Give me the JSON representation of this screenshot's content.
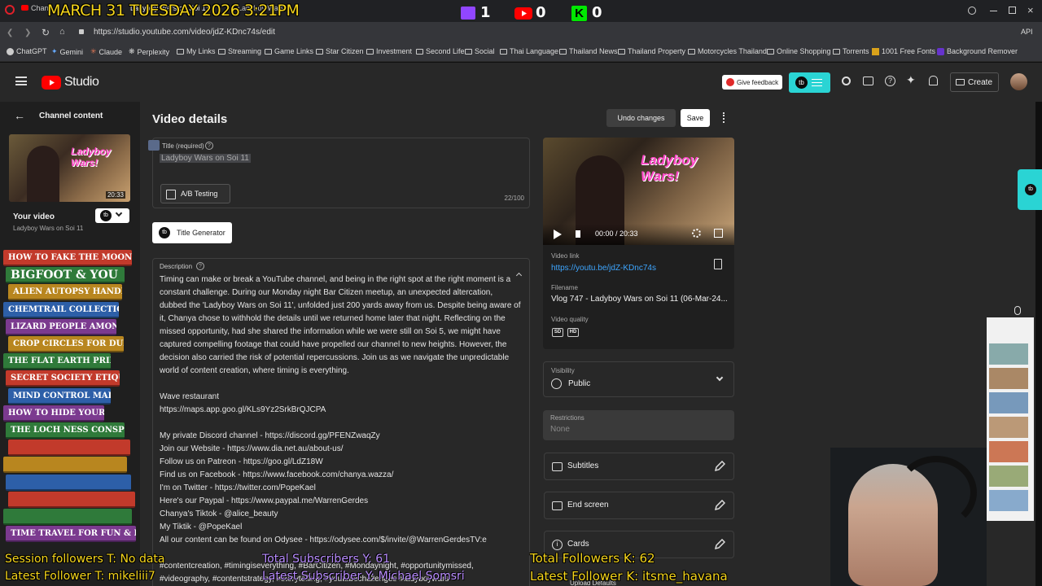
{
  "browser": {
    "tabs": [
      "Chann",
      "Ladyboy Wars on Soi 11",
      "Ladyboy Wars"
    ],
    "url": "https://studio.youtube.com/video/jdZ-KDnc74s/edit",
    "bookmarks": [
      "ChatGPT",
      "Gemini",
      "Claude",
      "Perplexity",
      "My Links",
      "Streaming",
      "Game Links",
      "Star Citizen",
      "Investment",
      "Second Life",
      "Social",
      "Thai Language",
      "Thailand News",
      "Thailand Property",
      "Motorcycles Thailand",
      "Online Shopping",
      "Torrents",
      "1001 Free Fonts",
      "Background Remover"
    ]
  },
  "overlay": {
    "datetime": "MARCH 31 TUESDAY 2026 3:21PM",
    "twitch_count": "1",
    "youtube_count": "0",
    "kick_count": "0",
    "session_followers": "Session followers T: No data",
    "latest_follower_t": "Latest Follower T: mikeliii7",
    "total_subscribers": "Total Subscribers Y: 61",
    "latest_subscriber": "Latest Subscriber Y: Michael Somsri",
    "total_followers_k": "Total Followers K: 62",
    "latest_follower_k": "Latest Follower K: itsme_havana"
  },
  "studio": {
    "logo_text": "Studio",
    "feedback": "Give feedback",
    "create": "Create"
  },
  "nav": {
    "back_label": "Channel content",
    "duration": "20:33",
    "your_video": "Your video",
    "video_title": "Ladyboy Wars on Soi 11",
    "books": [
      "HOW TO FAKE THE MOON LANDING",
      "BIGFOOT & YOU",
      "ALIEN AUTOPSY HANDBOOK",
      "CHEMTRAIL COLLECTION GUIDE",
      "LIZARD PEOPLE AMONG US",
      "CROP CIRCLES FOR DUMMIES",
      "THE FLAT EARTH PRIMER",
      "SECRET SOCIETY ETIQUETTE",
      "MIND CONTROL MADE EASY",
      "HOW TO HIDE YOUR BUNKER",
      "THE LOCH NESS CONSPIRACY",
      "",
      "",
      "",
      "",
      "",
      "TIME TRAVEL FOR FUN & PROFIT"
    ]
  },
  "details": {
    "heading": "Video details",
    "undo": "Undo changes",
    "save": "Save",
    "title_label": "Title (required)",
    "title_value": "Ladyboy Wars on Soi 11",
    "ab_testing": "A/B Testing",
    "title_count": "22/100",
    "title_generator": "Title Generator",
    "desc_label": "Description",
    "desc_lines": [
      "Timing can make or break a YouTube channel, and being in the right spot at the right moment is a",
      "constant challenge. During our Monday night Bar Citizen meetup, an unexpected altercation,",
      "dubbed the 'Ladyboy Wars on Soi 11', unfolded just 200 yards away from us. Despite being aware of",
      "it, Chanya chose to withhold the details until we returned home later that night. Reflecting on the",
      "missed opportunity, had she shared the information while we were still on Soi 5, we might have",
      "captured compelling footage that could have propelled our channel to new heights. However, the",
      "decision also carried the risk of potential repercussions. Join us as we navigate the unpredictable",
      "world of content creation, where timing is everything.",
      "",
      "Wave restaurant",
      "https://maps.app.goo.gl/KLs9Yz2SrkBrQJCPA",
      "",
      "My private Discord channel - https://discord.gg/PFENZwaqZy",
      "Join our Website - https://www.dia.net.au/about-us/",
      "Follow us on Patreon - https://goo.gl/LdZ18W",
      "Find us on Facebook - https://www.facebook.com/chanya.wazza/",
      "I'm on Twitter - https://twitter.com/PopeKael",
      "Here's our Paypal - https://www.paypal.me/WarrenGerdes",
      "Chanya's Tiktok - @alice_beauty",
      "My Tiktik - @PopeKael",
      "All our content can be found on Odysee - https://odysee.com/$/invite/@WarrenGerdesTV:e",
      "",
      "#contentcreation, #timingiseverything, #BarCitizen, #Mondaynight, #opportunitymissed,",
      "#videography, #contentstrategy, #storytelling, #youtubechallenges #ladyboywars"
    ]
  },
  "side": {
    "player_time": "00:00 / 20:33",
    "thumb_text": "Ladyboy Wars!",
    "video_link_label": "Video link",
    "video_link": "https://youtu.be/jdZ-KDnc74s",
    "filename_label": "Filename",
    "filename": "Vlog 747 - Ladyboy Wars on Soi 11 (06-Mar-24...",
    "quality_label": "Video quality",
    "quality_sd": "SD",
    "quality_hd": "HD",
    "visibility_label": "Visibility",
    "visibility_value": "Public",
    "restrictions_label": "Restrictions",
    "restrictions_value": "None",
    "subtitles": "Subtitles",
    "end_screen": "End screen",
    "cards": "Cards",
    "upload_defaults": "Upload Defaults"
  },
  "colors": {
    "accent": "#3ea6ff",
    "yt_red": "#ff0000",
    "bg": "#282828",
    "book_colors": [
      "#c23a2b",
      "#2f7a3a",
      "#b8861f",
      "#2d5fa8",
      "#7b3a8f",
      "#b8861f",
      "#2f7a3a",
      "#c23a2b",
      "#2d5fa8",
      "#7b3a8f",
      "#2f7a3a",
      "#c23a2b",
      "#b8861f",
      "#2d5fa8",
      "#c23a2b",
      "#2f7a3a",
      "#7b3a8f"
    ]
  }
}
